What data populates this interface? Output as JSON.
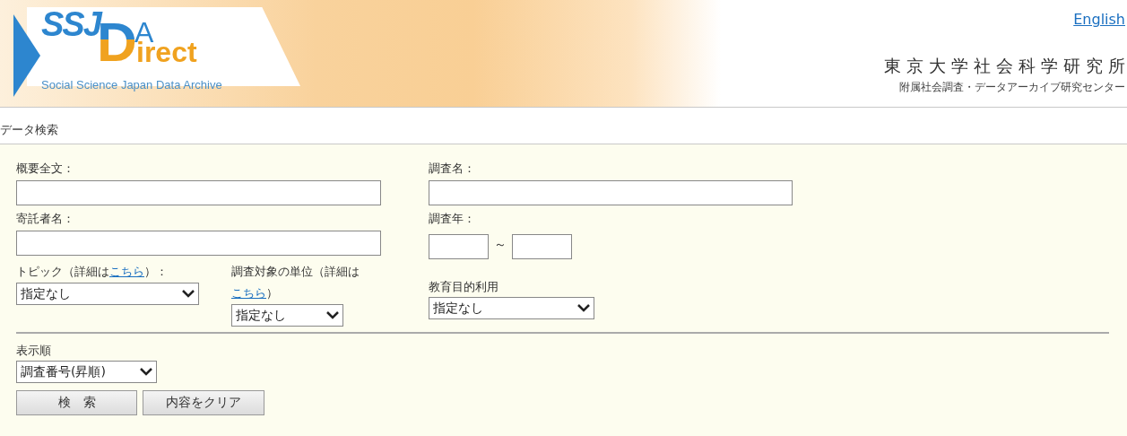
{
  "header": {
    "logo": {
      "ssj": "SSJ",
      "d": "D",
      "a": "A",
      "rest": "irect",
      "subtitle": "Social Science Japan Data Archive"
    },
    "english_link": "English",
    "institute": "東京大学社会科学研究所",
    "center": "附属社会調査・データアーカイブ研究センター"
  },
  "section_title": "データ検索",
  "form": {
    "full_text": {
      "label": "概要全文："
    },
    "depositor": {
      "label": "寄託者名："
    },
    "survey_name": {
      "label": "調査名："
    },
    "survey_year": {
      "label": "調査年：",
      "separator": "～"
    },
    "topic": {
      "label_before": "トピック（詳細は",
      "link": "こちら",
      "label_after": "）：",
      "value": "指定なし"
    },
    "unit": {
      "label_before": "調査対象の単位（詳細は",
      "link": "こちら",
      "label_after": "）",
      "value": "指定なし"
    },
    "education": {
      "label": "教育目的利用",
      "value": "指定なし"
    },
    "sort": {
      "label": "表示順",
      "value": "調査番号(昇順)"
    },
    "buttons": [
      {
        "label": "検　索",
        "kind": "submit"
      },
      {
        "label": "内容をクリア",
        "kind": "reset"
      }
    ]
  }
}
